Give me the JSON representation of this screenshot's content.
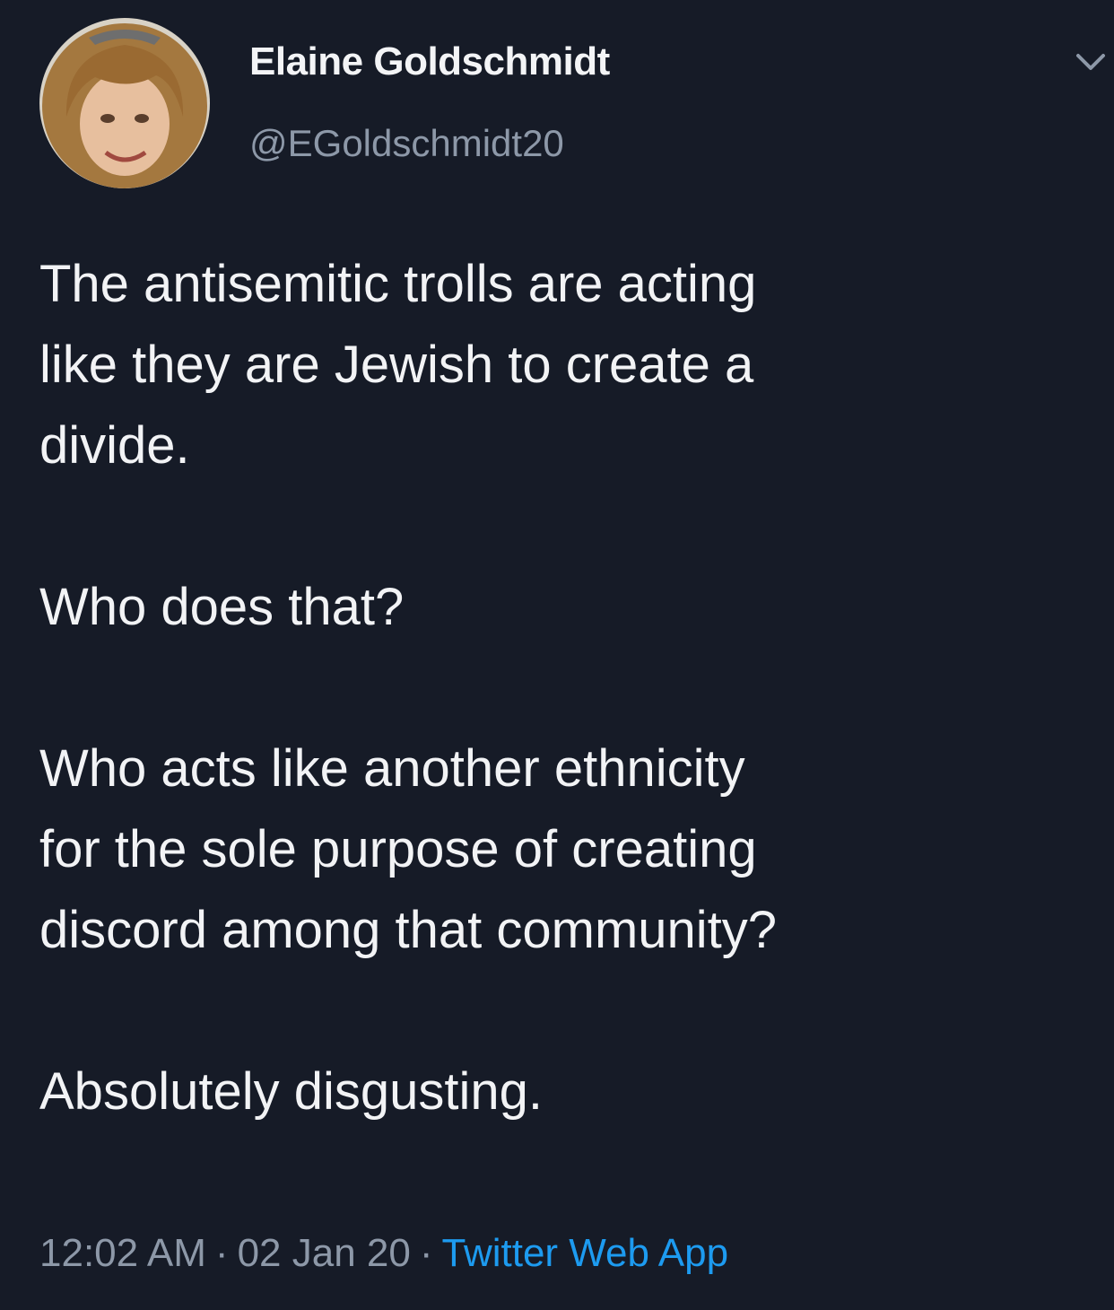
{
  "author": {
    "display_name": "Elaine Goldschmidt",
    "handle": "@EGoldschmidt20",
    "avatar_icon": "profile-photo"
  },
  "tweet": {
    "paragraphs": [
      "The antisemitic trolls are acting\nlike they are Jewish to create a\ndivide.",
      "Who does that?",
      "Who acts like another ethnicity\nfor the sole purpose of creating\ndiscord among that community?",
      "Absolutely disgusting."
    ],
    "time": "12:02 AM",
    "separator": "·",
    "date": "02 Jan 20",
    "source": "Twitter Web App"
  },
  "icons": {
    "more_options": "chevron-down-icon"
  },
  "colors": {
    "background": "#161b27",
    "text": "#f2f3f5",
    "muted": "#8d98a8",
    "link": "#1d9bf0"
  }
}
